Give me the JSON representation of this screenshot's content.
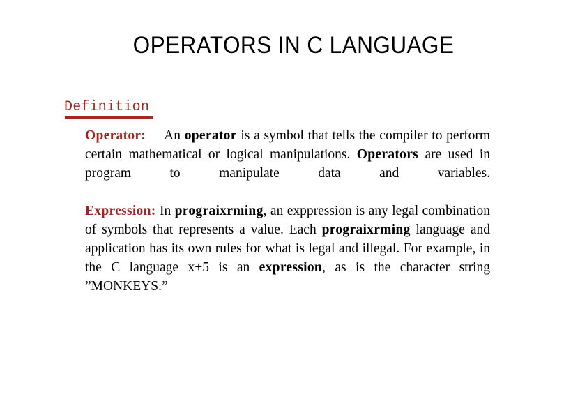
{
  "slide": {
    "title": "OPERATORS IN C LANGUAGE",
    "background_color": "#FFFFFF",
    "accent_color": "#9B2722",
    "text_color": "#000000"
  },
  "heading": {
    "label": "Definition",
    "color": "#9B2722",
    "underline_color": "#A32A22"
  },
  "content": {
    "operator_paragraph": {
      "lead_label": "Operator:",
      "segments": {
        "s1": "An ",
        "s2": "operator",
        "s3": " is a symbol that tells the compiler to perform  certain mathematical or logical manipulations. ",
        "s4": "Operators",
        "s5": " are used in program  to manipulate data and variables."
      }
    },
    "expression_paragraph": {
      "lead_label": "Expression:",
      "segments": {
        "s1": " In ",
        "s2": "prograixrming",
        "s3": ", an exppression is any legal combination of symbols that represents a value. Each ",
        "s4": "prograixrming",
        "s5": " language and application has its own rules for what is legal and illegal. For example, in the C language x+5 is an ",
        "s6": "expression",
        "s7": ", as is the  character string ”MONKEYS.”"
      }
    }
  }
}
